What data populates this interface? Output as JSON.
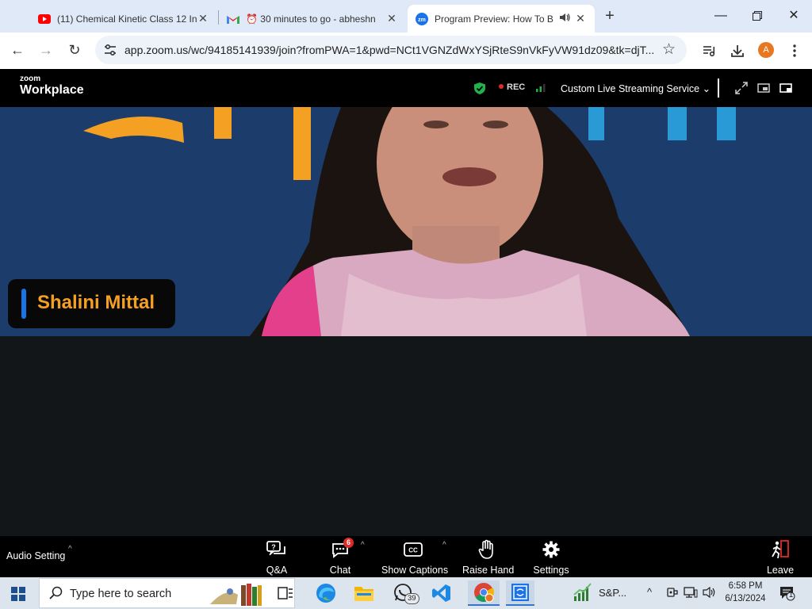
{
  "browser": {
    "tabs": [
      {
        "title": "(11) Chemical Kinetic Class 12 In",
        "icon": "youtube-icon"
      },
      {
        "title": "⏰ 30 minutes to go - abheshn",
        "icon": "gmail-icon"
      },
      {
        "title": "Program Preview: How To B",
        "icon": "zoom-icon",
        "active": true
      }
    ],
    "url": "app.zoom.us/wc/94185141939/join?fromPWA=1&pwd=NCt1VGNZdWxYSjRteS9nVkFyVW91dz09&tk=djT...",
    "profile_initial": "A"
  },
  "zoom": {
    "logo_small": "zoom",
    "logo_big": "Workplace",
    "rec_label": "REC",
    "streaming_label": "Custom Live Streaming Service",
    "participant_name": "Shalini Mittal",
    "audio_setting": "Audio Setting",
    "controls": [
      {
        "label": "Q&A",
        "icon": "qa-icon"
      },
      {
        "label": "Chat",
        "icon": "chat-icon",
        "badge": "6"
      },
      {
        "label": "Show Captions",
        "icon": "captions-icon"
      },
      {
        "label": "Raise Hand",
        "icon": "hand-icon"
      },
      {
        "label": "Settings",
        "icon": "gear-icon"
      }
    ],
    "leave_label": "Leave"
  },
  "taskbar": {
    "search_placeholder": "Type here to search",
    "whatsapp_badge": "39",
    "stock_label": "S&P...",
    "time": "6:58 PM",
    "date": "6/13/2024",
    "notification_count": "1"
  },
  "colors": {
    "zoom_blue": "#1a73e8",
    "rec_red": "#e02a2a",
    "name_orange": "#f4a023",
    "video_bg": "#1c3c6c"
  }
}
